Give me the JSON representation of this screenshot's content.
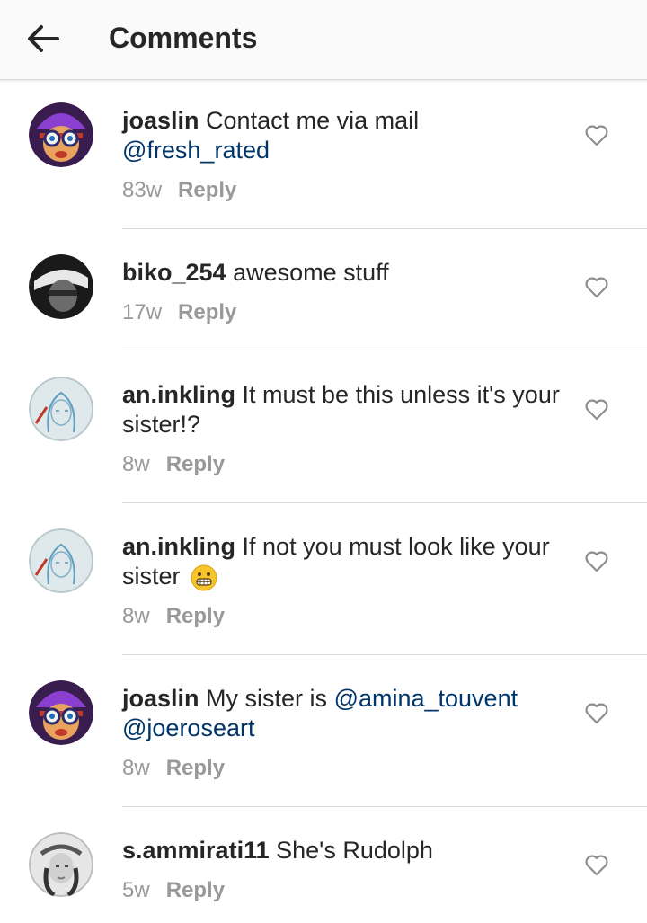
{
  "header": {
    "title": "Comments"
  },
  "comments": [
    {
      "username": "joaslin",
      "text": "Contact me via mail",
      "mention": "@fresh_rated",
      "time": "83w",
      "reply": "Reply"
    },
    {
      "username": "biko_254",
      "text": "awesome stuff",
      "time": "17w",
      "reply": "Reply"
    },
    {
      "username": "an.inkling",
      "text": "It must be this unless it's your sister!?",
      "time": "8w",
      "reply": "Reply"
    },
    {
      "username": "an.inkling",
      "text": "If not you must look like your sister",
      "emoji": "grinning-face",
      "time": "8w",
      "reply": "Reply"
    },
    {
      "username": "joaslin",
      "text": "My sister is",
      "mention": "@amina_touvent",
      "mention2": "@joeroseart",
      "time": "8w",
      "reply": "Reply"
    },
    {
      "username": "s.ammirati11",
      "text": "She's Rudolph",
      "time": "5w",
      "reply": "Reply"
    }
  ],
  "colors": {
    "mention": "#003569",
    "meta": "#999999",
    "text": "#262626"
  }
}
